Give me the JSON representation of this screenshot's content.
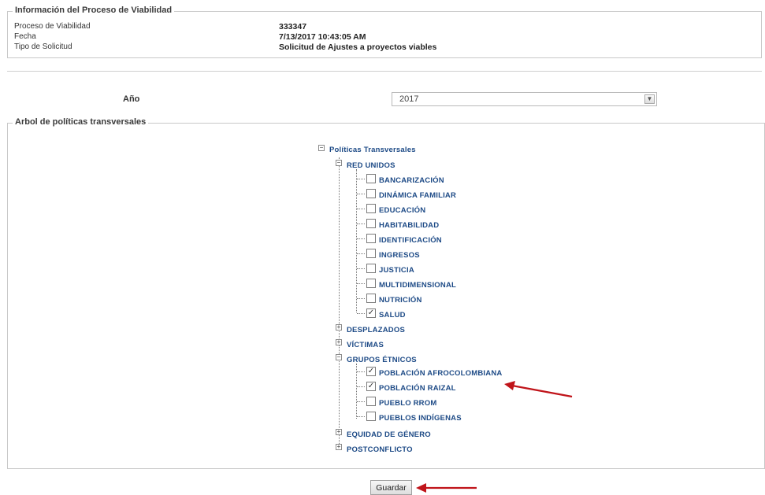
{
  "info": {
    "legend": "Información del Proceso de Viabilidad",
    "rows": [
      {
        "label": "Proceso de Viabilidad",
        "value": "333347"
      },
      {
        "label": "Fecha",
        "value": "7/13/2017 10:43:05 AM"
      },
      {
        "label": "Tipo de Solicitud",
        "value": "Solicitud de Ajustes a proyectos viables"
      }
    ]
  },
  "year": {
    "label": "Año",
    "selected": "2017"
  },
  "tree": {
    "legend": "Arbol de políticas transversales",
    "root": "Políticas Transversales",
    "red_unidos": {
      "label": "RED UNIDOS",
      "items": [
        {
          "label": "BANCARIZACIÓN",
          "checked": false
        },
        {
          "label": "DINÁMICA FAMILIAR",
          "checked": false
        },
        {
          "label": "EDUCACIÓN",
          "checked": false
        },
        {
          "label": "HABITABILIDAD",
          "checked": false
        },
        {
          "label": "IDENTIFICACIÓN",
          "checked": false
        },
        {
          "label": "INGRESOS",
          "checked": false
        },
        {
          "label": "JUSTICIA",
          "checked": false
        },
        {
          "label": "MULTIDIMENSIONAL",
          "checked": false
        },
        {
          "label": "NUTRICIÓN",
          "checked": false
        },
        {
          "label": "SALUD",
          "checked": true
        }
      ]
    },
    "desplazados": "DESPLAZADOS",
    "victimas": "VÍCTIMAS",
    "grupos": {
      "label": "GRUPOS ÉTNICOS",
      "items": [
        {
          "label": "POBLACIÓN AFROCOLOMBIANA",
          "checked": true
        },
        {
          "label": "POBLACIÓN RAIZAL",
          "checked": true
        },
        {
          "label": "PUEBLO RROM",
          "checked": false
        },
        {
          "label": "PUEBLOS INDÍGENAS",
          "checked": false
        }
      ]
    },
    "equidad": "EQUIDAD DE GÉNERO",
    "postconflicto": "POSTCONFLICTO"
  },
  "save_label": "Guardar",
  "colors": {
    "link": "#1d4a86",
    "arrow": "#c0141a"
  }
}
